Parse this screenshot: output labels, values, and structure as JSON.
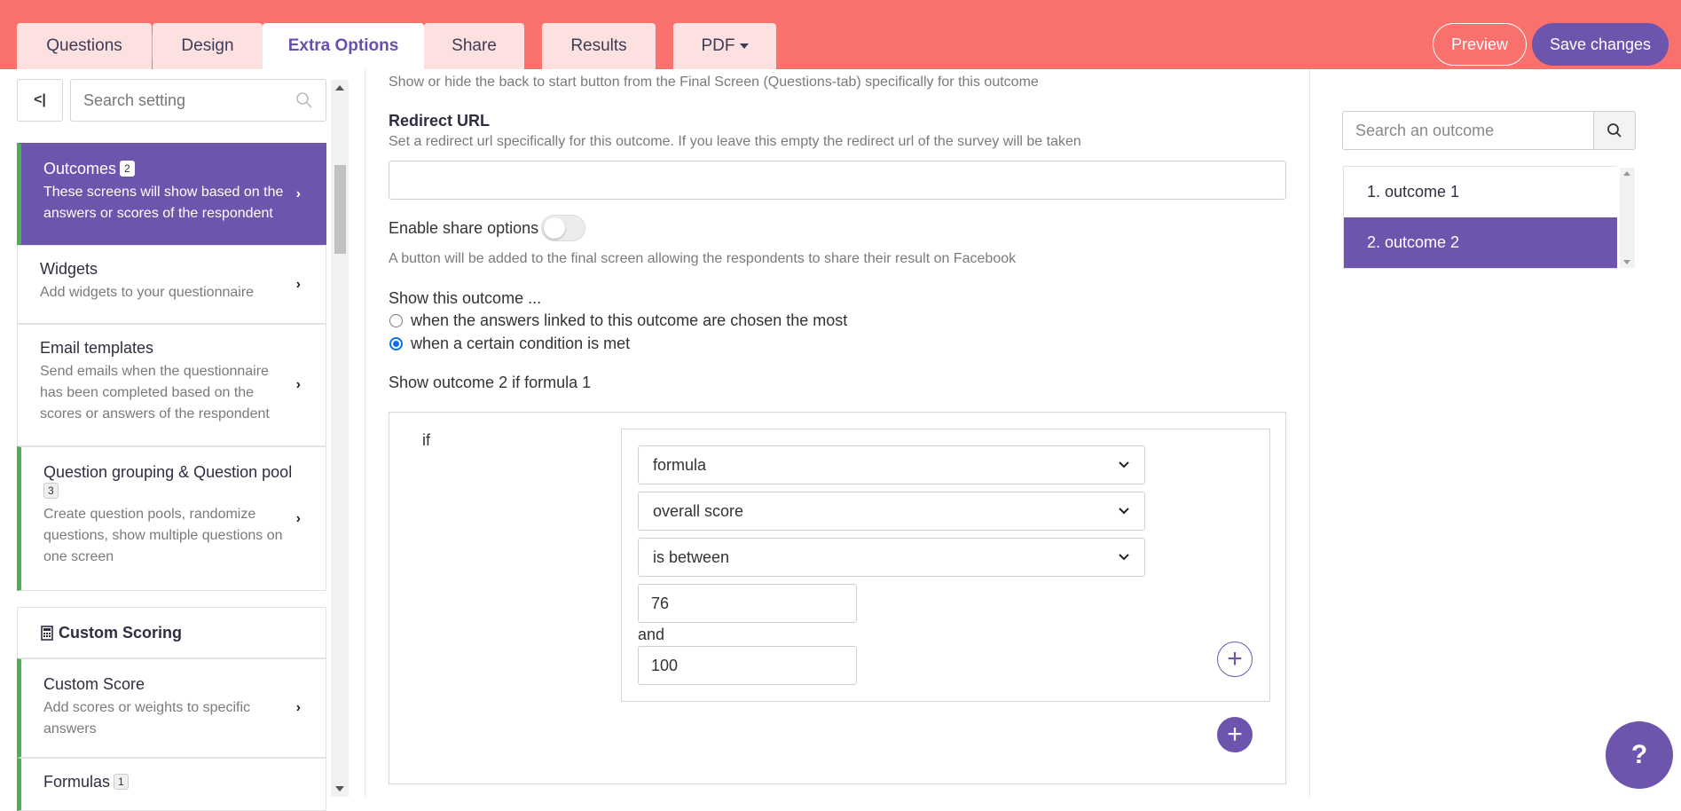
{
  "tabs": [
    {
      "label": "Questions"
    },
    {
      "label": "Design"
    },
    {
      "label": "Extra Options"
    },
    {
      "label": "Share"
    },
    {
      "label": "Results"
    },
    {
      "label": "PDF"
    }
  ],
  "header_buttons": {
    "preview": "Preview",
    "save": "Save changes"
  },
  "sidebar": {
    "collapse_label": "<|",
    "search_placeholder": "Search setting",
    "items": [
      {
        "title": "Outcomes",
        "badge": "2",
        "desc": "These screens will show based on the answers or scores of the respondent"
      },
      {
        "title": "Widgets",
        "desc": "Add widgets to your questionnaire"
      },
      {
        "title": "Email templates",
        "desc": "Send emails when the questionnaire has been completed based on the scores or answers of the respondent"
      },
      {
        "title": "Question grouping & Question pool",
        "badge": "3",
        "desc": "Create question pools, randomize questions, show multiple questions on one screen"
      },
      {
        "title": "Custom Score",
        "desc": "Add scores or weights to specific answers"
      },
      {
        "title": "Formulas",
        "badge": "1"
      }
    ],
    "custom_scoring_heading": "Custom Scoring"
  },
  "main": {
    "back_to_start_help": "Show or hide the back to start button from the Final Screen (Questions-tab) specifically for this outcome",
    "redirect_label": "Redirect URL",
    "redirect_help": "Set a redirect url specifically for this outcome. If you leave this empty the redirect url of the survey will be taken",
    "redirect_value": "",
    "share_label": "Enable share options",
    "share_enabled": false,
    "share_help": "A button will be added to the final screen allowing the respondents to share their result on Facebook",
    "show_outcome_label": "Show this outcome ...",
    "radio_option_1": "when the answers linked to this outcome are chosen the most",
    "radio_option_2": "when a certain condition is met",
    "selected_option": 2,
    "formula_summary": "Show outcome 2 if formula 1",
    "if_label": "if",
    "select_1": "formula",
    "select_2": "overall score",
    "select_3": "is between",
    "value_from": "76",
    "and_label": "and",
    "value_to": "100"
  },
  "outcomes_panel": {
    "search_placeholder": "Search an outcome",
    "items": [
      {
        "label": "1. outcome 1"
      },
      {
        "label": "2. outcome 2"
      }
    ],
    "selected_index": 1
  },
  "help_button": "?",
  "colors": {
    "header": "#f8716d",
    "accent": "#6d54ad",
    "green": "#4caf50"
  }
}
